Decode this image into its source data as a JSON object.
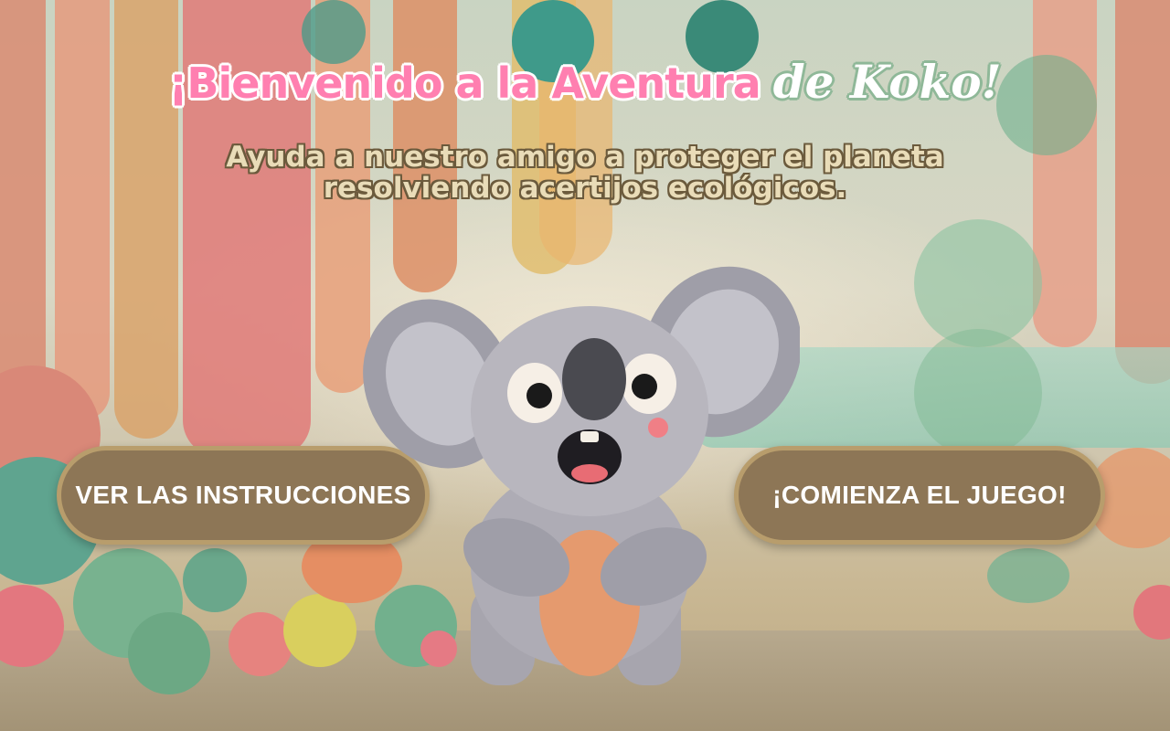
{
  "title": {
    "part1": "¡Bienvenido a la Aventura",
    "part2": "de Koko!"
  },
  "subtitle": {
    "line1": "Ayuda a nuestro amigo a proteger el planeta",
    "line2": "resolviendo acertijos ecológicos."
  },
  "buttons": {
    "instructions": "VER LAS INSTRUCCIONES",
    "start": "¡COMIENZA EL JUEGO!"
  },
  "colors": {
    "title_pink": "#ff7fb0",
    "title_script_outline": "#8fb898",
    "subtitle_fill": "#e9dcb8",
    "button_fill": "#8d7656",
    "button_border": "#b89d6c"
  },
  "character": {
    "icon": "koala-character"
  }
}
